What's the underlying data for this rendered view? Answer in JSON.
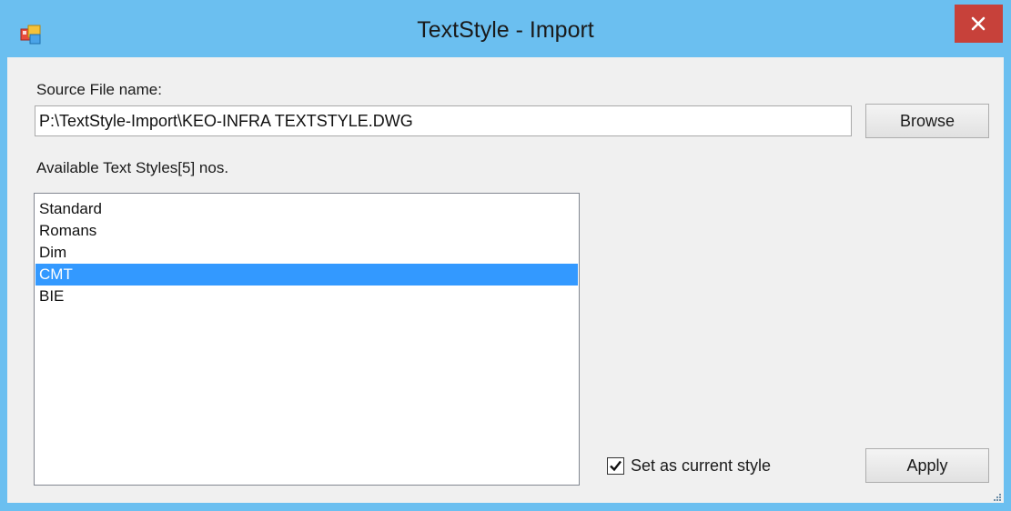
{
  "window": {
    "title": "TextStyle - Import",
    "icon": "app-window-icon",
    "close_icon": "close-icon"
  },
  "source": {
    "label": "Source File name:",
    "path_value": "P:\\TextStyle-Import\\KEO-INFRA TEXTSTYLE.DWG",
    "browse_label": "Browse"
  },
  "styles": {
    "label": "Available Text Styles[5] nos.",
    "items": [
      "Standard",
      "Romans",
      "Dim",
      "CMT",
      "BIE"
    ],
    "selected": "CMT"
  },
  "options": {
    "set_current_label": "Set as current style",
    "set_current_checked": true,
    "apply_label": "Apply"
  },
  "colors": {
    "titlebar": "#6bbff0",
    "close_button": "#c7413a",
    "selection": "#3399ff"
  }
}
